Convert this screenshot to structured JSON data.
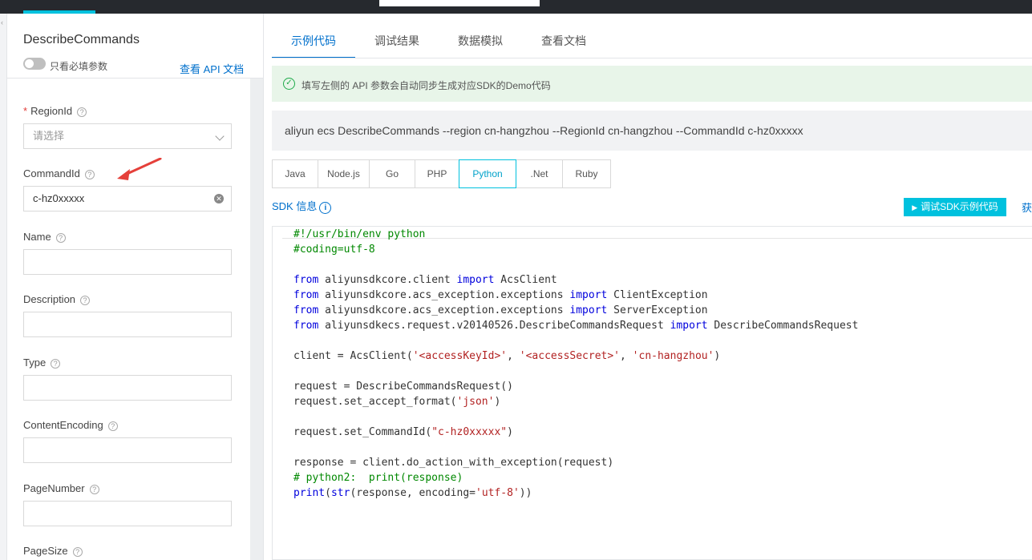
{
  "left_panel": {
    "api_name": "DescribeCommands",
    "toggle_label": "只看必填参数",
    "api_doc_link": "查看 API 文档",
    "fields": [
      {
        "label": "RegionId",
        "required": true,
        "placeholder": "请选择",
        "value": ""
      },
      {
        "label": "CommandId",
        "required": false,
        "value": "c-hz0xxxxx"
      },
      {
        "label": "Name",
        "required": false,
        "value": ""
      },
      {
        "label": "Description",
        "required": false,
        "value": ""
      },
      {
        "label": "Type",
        "required": false,
        "value": ""
      },
      {
        "label": "ContentEncoding",
        "required": false,
        "value": ""
      },
      {
        "label": "PageNumber",
        "required": false,
        "value": ""
      },
      {
        "label": "PageSize",
        "required": false,
        "value": ""
      }
    ],
    "help_glyph": "?",
    "required_mark": "*",
    "clear_glyph": "✕"
  },
  "right_panel": {
    "tabs": [
      "示例代码",
      "调试结果",
      "数据模拟",
      "查看文档"
    ],
    "active_tab": "示例代码",
    "notice": "填写左侧的 API 参数会自动同步生成对应SDK的Demo代码",
    "cli_command": "aliyun ecs DescribeCommands --region cn-hangzhou --RegionId cn-hangzhou --CommandId c-hz0xxxxx",
    "languages": [
      "Java",
      "Node.js",
      "Go",
      "PHP",
      "Python",
      ".Net",
      "Ruby"
    ],
    "active_language": "Python",
    "sdk_info": "SDK 信息",
    "debug_button": "调试SDK示例代码",
    "get_link": "获"
  },
  "code": {
    "l1": "#!/usr/bin/env python",
    "l2": "#coding=utf-8",
    "from": "from",
    "import": "import",
    "mod1": " aliyunsdkcore.client ",
    "cls1": " AcsClient",
    "mod2": " aliyunsdkcore.acs_exception.exceptions ",
    "cls2": " ClientException",
    "cls3": " ServerException",
    "mod4": " aliyunsdkecs.request.v20140526.DescribeCommandsRequest ",
    "cls4": " DescribeCommandsRequest",
    "client_pre": "client = AcsClient(",
    "s_key": "'<accessKeyId>'",
    "comma": ", ",
    "s_secret": "'<accessSecret>'",
    "s_region": "'cn-hangzhou'",
    "close": ")",
    "req1": "request = DescribeCommandsRequest()",
    "req2_pre": "request.set_accept_format(",
    "s_json": "'json'",
    "req3_pre": "request.set_CommandId(",
    "s_cmd": "\"c-hz0xxxxx\"",
    "resp": "response = client.do_action_with_exception(request)",
    "cm_py2": "# python2:  print(response)",
    "print_kw": "print",
    "open": "(",
    "str_kw": "str",
    "print_mid": "(response, encoding=",
    "s_utf": "'utf-8'",
    "print_end": "))"
  },
  "colors": {
    "topbar": "#26292e",
    "accent": "#00c1de",
    "link": "#0070cc",
    "notice_bg": "#e8f5e9",
    "success": "#1eaa4a",
    "arrow": "#e5403a"
  },
  "icons": [
    "help-icon",
    "chevron-down-icon",
    "clear-icon",
    "check-circle-icon",
    "info-icon",
    "play-icon",
    "arrow-annotation"
  ]
}
